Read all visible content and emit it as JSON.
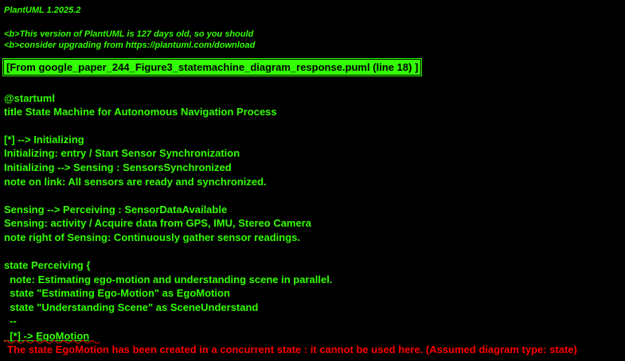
{
  "colors": {
    "background": "#000000",
    "text": "#33FF02",
    "error": "#FF0000"
  },
  "header": {
    "version": "PlantUML 1.2025.2",
    "notice_line1": "<b>This version of PlantUML is 127 days old, so you should",
    "notice_line2": "<b>consider upgrading from https://plantuml.com/download"
  },
  "source_label": "[From google_paper_244_Figure3_statemachine_diagram_response.puml (line 18) ]",
  "code_lines": [
    "@startuml",
    "title State Machine for Autonomous Navigation Process",
    "",
    "[*] --> Initializing",
    "Initializing: entry / Start Sensor Synchronization",
    "Initializing --> Sensing : SensorsSynchronized",
    "note on link: All sensors are ready and synchronized.",
    "",
    "Sensing --> Perceiving : SensorDataAvailable",
    "Sensing: activity / Acquire data from GPS, IMU, Stereo Camera",
    "note right of Sensing: Continuously gather sensor readings.",
    "",
    "state Perceiving {",
    "  note: Estimating ego-motion and understanding scene in parallel.",
    "  state \"Estimating Ego-Motion\" as EgoMotion",
    "  state \"Understanding Scene\" as SceneUnderstand",
    "  --"
  ],
  "error_line": "  [*] -> EgoMotion",
  "error_message": "The state EgoMotion has been created in a concurrent state : it cannot be used here. (Assumed diagram type: state)"
}
